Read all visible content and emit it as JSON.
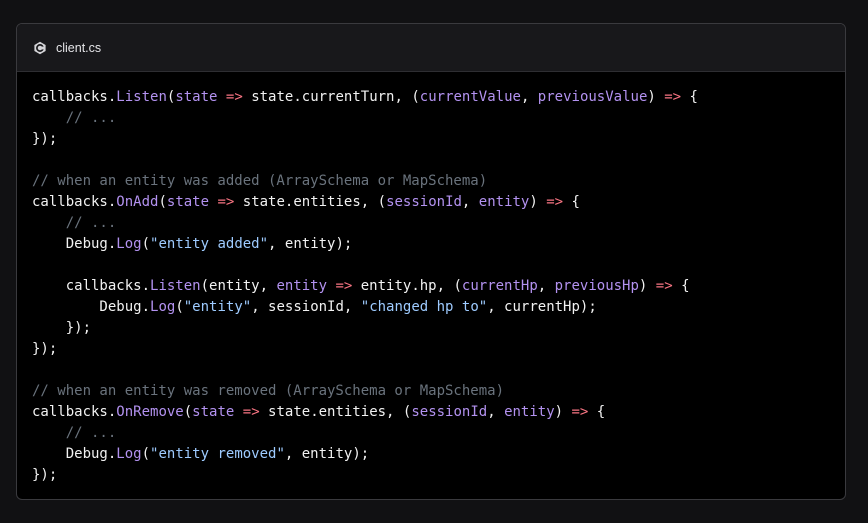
{
  "tab": {
    "filename": "client.cs",
    "icon": "csharp-file-icon"
  },
  "colors": {
    "plain": "#f2f2f2",
    "method": "#b392f0",
    "param": "#b392f0",
    "operator": "#f97583",
    "string": "#9ecbff",
    "comment": "#6a737d"
  },
  "code": {
    "language": "csharp",
    "lines": [
      [
        [
          "plain",
          "callbacks."
        ],
        [
          "method",
          "Listen"
        ],
        [
          "plain",
          "("
        ],
        [
          "param",
          "state"
        ],
        [
          "plain",
          " "
        ],
        [
          "op",
          "=>"
        ],
        [
          "plain",
          " state.currentTurn, ("
        ],
        [
          "param",
          "currentValue"
        ],
        [
          "plain",
          ", "
        ],
        [
          "param",
          "previousValue"
        ],
        [
          "plain",
          ") "
        ],
        [
          "op",
          "=>"
        ],
        [
          "plain",
          " {"
        ]
      ],
      [
        [
          "plain",
          "    "
        ],
        [
          "comment",
          "// ..."
        ]
      ],
      [
        [
          "plain",
          "});"
        ]
      ],
      [],
      [
        [
          "comment",
          "// when an entity was added (ArraySchema or MapSchema)"
        ]
      ],
      [
        [
          "plain",
          "callbacks."
        ],
        [
          "method",
          "OnAdd"
        ],
        [
          "plain",
          "("
        ],
        [
          "param",
          "state"
        ],
        [
          "plain",
          " "
        ],
        [
          "op",
          "=>"
        ],
        [
          "plain",
          " state.entities, ("
        ],
        [
          "param",
          "sessionId"
        ],
        [
          "plain",
          ", "
        ],
        [
          "param",
          "entity"
        ],
        [
          "plain",
          ") "
        ],
        [
          "op",
          "=>"
        ],
        [
          "plain",
          " {"
        ]
      ],
      [
        [
          "plain",
          "    "
        ],
        [
          "comment",
          "// ..."
        ]
      ],
      [
        [
          "plain",
          "    Debug."
        ],
        [
          "method",
          "Log"
        ],
        [
          "plain",
          "("
        ],
        [
          "string",
          "\"entity added\""
        ],
        [
          "plain",
          ", entity);"
        ]
      ],
      [],
      [
        [
          "plain",
          "    callbacks."
        ],
        [
          "method",
          "Listen"
        ],
        [
          "plain",
          "(entity, "
        ],
        [
          "param",
          "entity"
        ],
        [
          "plain",
          " "
        ],
        [
          "op",
          "=>"
        ],
        [
          "plain",
          " entity.hp, ("
        ],
        [
          "param",
          "currentHp"
        ],
        [
          "plain",
          ", "
        ],
        [
          "param",
          "previousHp"
        ],
        [
          "plain",
          ") "
        ],
        [
          "op",
          "=>"
        ],
        [
          "plain",
          " {"
        ]
      ],
      [
        [
          "plain",
          "        Debug."
        ],
        [
          "method",
          "Log"
        ],
        [
          "plain",
          "("
        ],
        [
          "string",
          "\"entity\""
        ],
        [
          "plain",
          ", sessionId, "
        ],
        [
          "string",
          "\"changed hp to\""
        ],
        [
          "plain",
          ", currentHp);"
        ]
      ],
      [
        [
          "plain",
          "    });"
        ]
      ],
      [
        [
          "plain",
          "});"
        ]
      ],
      [],
      [
        [
          "comment",
          "// when an entity was removed (ArraySchema or MapSchema)"
        ]
      ],
      [
        [
          "plain",
          "callbacks."
        ],
        [
          "method",
          "OnRemove"
        ],
        [
          "plain",
          "("
        ],
        [
          "param",
          "state"
        ],
        [
          "plain",
          " "
        ],
        [
          "op",
          "=>"
        ],
        [
          "plain",
          " state.entities, ("
        ],
        [
          "param",
          "sessionId"
        ],
        [
          "plain",
          ", "
        ],
        [
          "param",
          "entity"
        ],
        [
          "plain",
          ") "
        ],
        [
          "op",
          "=>"
        ],
        [
          "plain",
          " {"
        ]
      ],
      [
        [
          "plain",
          "    "
        ],
        [
          "comment",
          "// ..."
        ]
      ],
      [
        [
          "plain",
          "    Debug."
        ],
        [
          "method",
          "Log"
        ],
        [
          "plain",
          "("
        ],
        [
          "string",
          "\"entity removed\""
        ],
        [
          "plain",
          ", entity);"
        ]
      ],
      [
        [
          "plain",
          "});"
        ]
      ]
    ]
  }
}
